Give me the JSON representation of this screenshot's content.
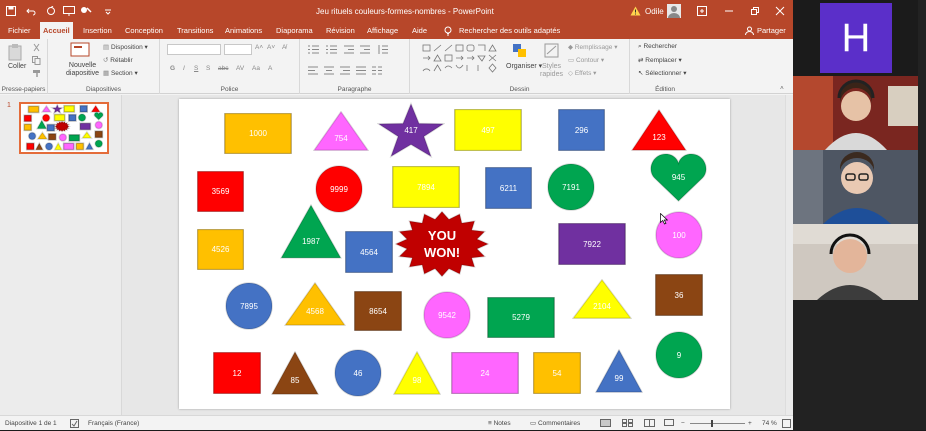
{
  "titlebar": {
    "document_title": "Jeu rituels couleurs-formes-nombres - PowerPoint",
    "user_name": "Odile"
  },
  "tabs": [
    "Fichier",
    "Accueil",
    "Insertion",
    "Conception",
    "Transitions",
    "Animations",
    "Diaporama",
    "Révision",
    "Affichage",
    "Aide"
  ],
  "search": {
    "label": "Rechercher des outils adaptés"
  },
  "share": {
    "label": "Partager"
  },
  "ribbon": {
    "clipboard": {
      "paste": "Coller",
      "label": "Presse-papiers"
    },
    "slides": {
      "new_slide_1": "Nouvelle",
      "new_slide_2": "diapositive",
      "layout": "Disposition",
      "reset": "Rétablir",
      "section": "Section",
      "label": "Diapositives"
    },
    "font": {
      "label": "Police"
    },
    "paragraph": {
      "label": "Paragraphe"
    },
    "drawing": {
      "arrange": "Organiser",
      "styles_1": "Styles",
      "styles_2": "rapides",
      "fill": "Remplissage",
      "outline": "Contour",
      "effects": "Effets",
      "label": "Dessin"
    },
    "editing": {
      "find": "Rechercher",
      "replace": "Remplacer",
      "select": "Sélectionner",
      "label": "Édition"
    }
  },
  "thumbnail": {
    "number": "1"
  },
  "slide": {
    "shapes": [
      {
        "label": "1000",
        "shape": "rect",
        "color": "#ffc000"
      },
      {
        "label": "754",
        "shape": "triangle",
        "color": "#ff66ff"
      },
      {
        "label": "417",
        "shape": "star",
        "color": "#7030a0"
      },
      {
        "label": "497",
        "shape": "rect",
        "color": "#ffff00"
      },
      {
        "label": "296",
        "shape": "rect",
        "color": "#4472c4"
      },
      {
        "label": "123",
        "shape": "triangle",
        "color": "#ff0000"
      },
      {
        "label": "3569",
        "shape": "rect",
        "color": "#ff0000"
      },
      {
        "label": "9999",
        "shape": "circle",
        "color": "#ff0000"
      },
      {
        "label": "7894",
        "shape": "rect",
        "color": "#ffff00"
      },
      {
        "label": "6211",
        "shape": "rect",
        "color": "#4472c4"
      },
      {
        "label": "7191",
        "shape": "circle",
        "color": "#00a550"
      },
      {
        "label": "945",
        "shape": "heart",
        "color": "#00a550"
      },
      {
        "label": "4526",
        "shape": "rect",
        "color": "#ffc000"
      },
      {
        "label": "1987",
        "shape": "triangle",
        "color": "#00a550"
      },
      {
        "label": "4564",
        "shape": "rect",
        "color": "#4472c4"
      },
      {
        "label": "YOU WON!",
        "shape": "burst",
        "color": "#c00000"
      },
      {
        "label": "7922",
        "shape": "rect",
        "color": "#7030a0"
      },
      {
        "label": "100",
        "shape": "circle",
        "color": "#ff66ff"
      },
      {
        "label": "7895",
        "shape": "circle",
        "color": "#4472c4"
      },
      {
        "label": "4568",
        "shape": "triangle",
        "color": "#ffc000"
      },
      {
        "label": "8654",
        "shape": "rect",
        "color": "#8b4513"
      },
      {
        "label": "9542",
        "shape": "circle",
        "color": "#ff66ff"
      },
      {
        "label": "5279",
        "shape": "rect",
        "color": "#00a550"
      },
      {
        "label": "2104",
        "shape": "triangle",
        "color": "#ffff00"
      },
      {
        "label": "36",
        "shape": "rect",
        "color": "#8b4513"
      },
      {
        "label": "12",
        "shape": "rect",
        "color": "#ff0000"
      },
      {
        "label": "85",
        "shape": "triangle",
        "color": "#8b4513"
      },
      {
        "label": "46",
        "shape": "circle",
        "color": "#4472c4"
      },
      {
        "label": "98",
        "shape": "triangle",
        "color": "#ffff00"
      },
      {
        "label": "24",
        "shape": "rect",
        "color": "#ff66ff"
      },
      {
        "label": "54",
        "shape": "rect",
        "color": "#ffc000"
      },
      {
        "label": "99",
        "shape": "triangle",
        "color": "#4472c4"
      },
      {
        "label": "9",
        "shape": "circle",
        "color": "#00a550"
      }
    ]
  },
  "statusbar": {
    "slide_info": "Diapositive 1 de 1",
    "language": "Français (France)",
    "notes": "Notes",
    "comments": "Commentaires",
    "zoom": "74 %"
  },
  "video": {
    "avatar_letter": "H",
    "avatar_color": "#5b2fc9"
  }
}
